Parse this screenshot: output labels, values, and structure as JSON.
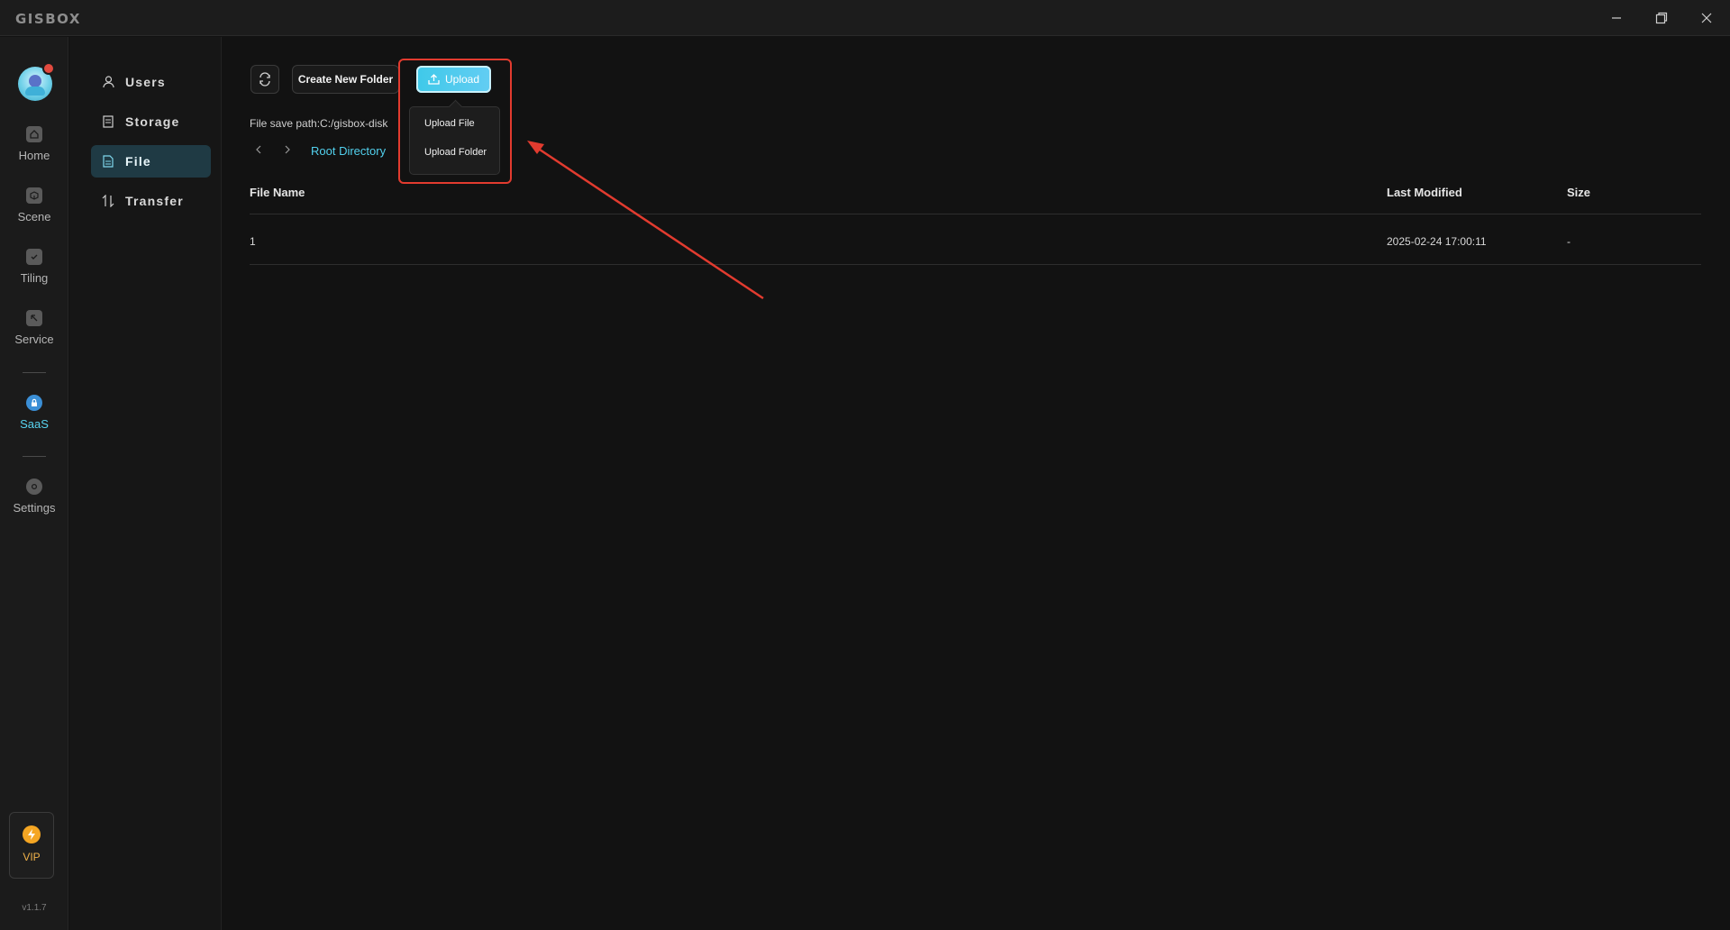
{
  "app": {
    "logo_text": "GISBOX"
  },
  "window_controls": {
    "minimize": "minimize-icon",
    "restore": "restore-icon",
    "close": "close-icon"
  },
  "rail": {
    "items": [
      {
        "label": "Home",
        "icon": "home-icon"
      },
      {
        "label": "Scene",
        "icon": "cube-icon"
      },
      {
        "label": "Tiling",
        "icon": "document-check-icon"
      },
      {
        "label": "Service",
        "icon": "service-icon"
      },
      {
        "label": "SaaS",
        "icon": "lock-icon",
        "active": true
      },
      {
        "label": "Settings",
        "icon": "gear-icon"
      }
    ],
    "vip_label": "VIP",
    "version": "v1.1.7"
  },
  "subnav": {
    "items": [
      {
        "label": "Users",
        "icon": "user-icon"
      },
      {
        "label": "Storage",
        "icon": "storage-icon"
      },
      {
        "label": "File",
        "icon": "file-icon",
        "active": true
      },
      {
        "label": "Transfer",
        "icon": "transfer-icon"
      }
    ]
  },
  "toolbar": {
    "create_folder_label": "Create New Folder",
    "upload_label": "Upload",
    "upload_menu": [
      "Upload File",
      "Upload Folder"
    ]
  },
  "path": {
    "save_path_text": "File save path:C:/gisbox-disk",
    "breadcrumb": "Root Directory"
  },
  "table": {
    "headers": {
      "name": "File Name",
      "modified": "Last Modified",
      "size": "Size"
    },
    "rows": [
      {
        "name": "1",
        "modified": "2025-02-24 17:00:11",
        "size": "-"
      }
    ]
  },
  "colors": {
    "accent": "#52d1ee",
    "highlight": "#e23b2f",
    "vip": "#f5a623"
  }
}
